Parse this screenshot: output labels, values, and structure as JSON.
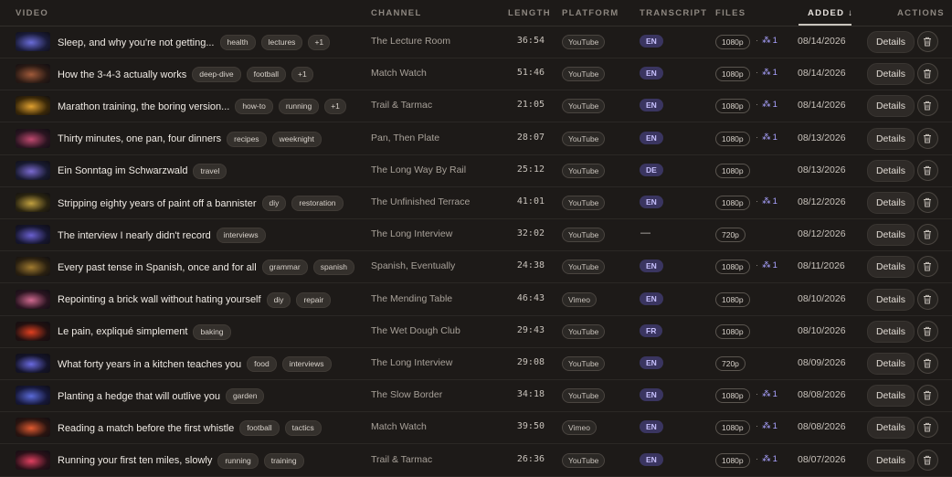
{
  "headers": {
    "video": "VIDEO",
    "channel": "CHANNEL",
    "length": "LENGTH",
    "platform": "PLATFORM",
    "transcript": "TRANSCRIPT",
    "files": "FILES",
    "added": "ADDED ↓",
    "actions": "ACTIONS"
  },
  "details_label": "Details",
  "rows": [
    {
      "title": "Sleep, and why you're not getting...",
      "tags": [
        "health",
        "lectures",
        "+1"
      ],
      "channel": "The Lecture Room",
      "length": "36:54",
      "platform": "YouTube",
      "transcript": "EN",
      "resolution": "1080p",
      "extra": "1",
      "date": "08/14/2026",
      "thumb": [
        "#1a1c3a",
        "#6a6cd8"
      ]
    },
    {
      "title": "How the 3-4-3 actually works",
      "tags": [
        "deep-dive",
        "football",
        "+1"
      ],
      "channel": "Match Watch",
      "length": "51:46",
      "platform": "YouTube",
      "transcript": "EN",
      "resolution": "1080p",
      "extra": "1",
      "date": "08/14/2026",
      "thumb": [
        "#2a1a14",
        "#a05a3a"
      ]
    },
    {
      "title": "Marathon training, the boring version...",
      "tags": [
        "how-to",
        "running",
        "+1"
      ],
      "channel": "Trail & Tarmac",
      "length": "21:05",
      "platform": "YouTube",
      "transcript": "EN",
      "resolution": "1080p",
      "extra": "1",
      "date": "08/14/2026",
      "thumb": [
        "#3a2808",
        "#e0a030"
      ]
    },
    {
      "title": "Thirty minutes, one pan, four dinners",
      "tags": [
        "recipes",
        "weeknight"
      ],
      "channel": "Pan, Then Plate",
      "length": "28:07",
      "platform": "YouTube",
      "transcript": "EN",
      "resolution": "1080p",
      "extra": "1",
      "date": "08/13/2026",
      "thumb": [
        "#2a1420",
        "#c04a70"
      ]
    },
    {
      "title": "Ein Sonntag im Schwarzwald",
      "tags": [
        "travel"
      ],
      "channel": "The Long Way By Rail",
      "length": "25:12",
      "platform": "YouTube",
      "transcript": "DE",
      "resolution": "1080p",
      "extra": "",
      "date": "08/13/2026",
      "thumb": [
        "#181a30",
        "#7a6ad0"
      ]
    },
    {
      "title": "Stripping eighty years of paint off a bannister",
      "tags": [
        "diy",
        "restoration"
      ],
      "channel": "The Unfinished Terrace",
      "length": "41:01",
      "platform": "YouTube",
      "transcript": "EN",
      "resolution": "1080p",
      "extra": "1",
      "date": "08/12/2026",
      "thumb": [
        "#2a2410",
        "#c0a040"
      ]
    },
    {
      "title": "The interview I nearly didn't record",
      "tags": [
        "interviews"
      ],
      "channel": "The Long Interview",
      "length": "32:02",
      "platform": "YouTube",
      "transcript": "—",
      "resolution": "720p",
      "extra": "",
      "date": "08/12/2026",
      "thumb": [
        "#161630",
        "#6a60d0"
      ]
    },
    {
      "title": "Every past tense in Spanish, once and for all",
      "tags": [
        "grammar",
        "spanish"
      ],
      "channel": "Spanish, Eventually",
      "length": "24:38",
      "platform": "YouTube",
      "transcript": "EN",
      "resolution": "1080p",
      "extra": "1",
      "date": "08/11/2026",
      "thumb": [
        "#2a2010",
        "#a07a30"
      ]
    },
    {
      "title": "Repointing a brick wall without hating yourself",
      "tags": [
        "diy",
        "repair"
      ],
      "channel": "The Mending Table",
      "length": "46:43",
      "platform": "Vimeo",
      "transcript": "EN",
      "resolution": "1080p",
      "extra": "",
      "date": "08/10/2026",
      "thumb": [
        "#2a1420",
        "#d06a90"
      ]
    },
    {
      "title": "Le pain, expliqué simplement",
      "tags": [
        "baking"
      ],
      "channel": "The Wet Dough Club",
      "length": "29:43",
      "platform": "YouTube",
      "transcript": "FR",
      "resolution": "1080p",
      "extra": "",
      "date": "08/10/2026",
      "thumb": [
        "#221010",
        "#e04020"
      ]
    },
    {
      "title": "What forty years in a kitchen teaches you",
      "tags": [
        "food",
        "interviews"
      ],
      "channel": "The Long Interview",
      "length": "29:08",
      "platform": "YouTube",
      "transcript": "EN",
      "resolution": "720p",
      "extra": "",
      "date": "08/09/2026",
      "thumb": [
        "#14142a",
        "#6a6ae0"
      ]
    },
    {
      "title": "Planting a hedge that will outlive you",
      "tags": [
        "garden"
      ],
      "channel": "The Slow Border",
      "length": "34:18",
      "platform": "YouTube",
      "transcript": "EN",
      "resolution": "1080p",
      "extra": "1",
      "date": "08/08/2026",
      "thumb": [
        "#16183a",
        "#5a6ad8"
      ]
    },
    {
      "title": "Reading a match before the first whistle",
      "tags": [
        "football",
        "tactics"
      ],
      "channel": "Match Watch",
      "length": "39:50",
      "platform": "Vimeo",
      "transcript": "EN",
      "resolution": "1080p",
      "extra": "1",
      "date": "08/08/2026",
      "thumb": [
        "#2a1410",
        "#e05a30"
      ]
    },
    {
      "title": "Running your first ten miles, slowly",
      "tags": [
        "running",
        "training"
      ],
      "channel": "Trail & Tarmac",
      "length": "26:36",
      "platform": "YouTube",
      "transcript": "EN",
      "resolution": "1080p",
      "extra": "1",
      "date": "08/07/2026",
      "thumb": [
        "#2a1018",
        "#e04060"
      ]
    }
  ]
}
